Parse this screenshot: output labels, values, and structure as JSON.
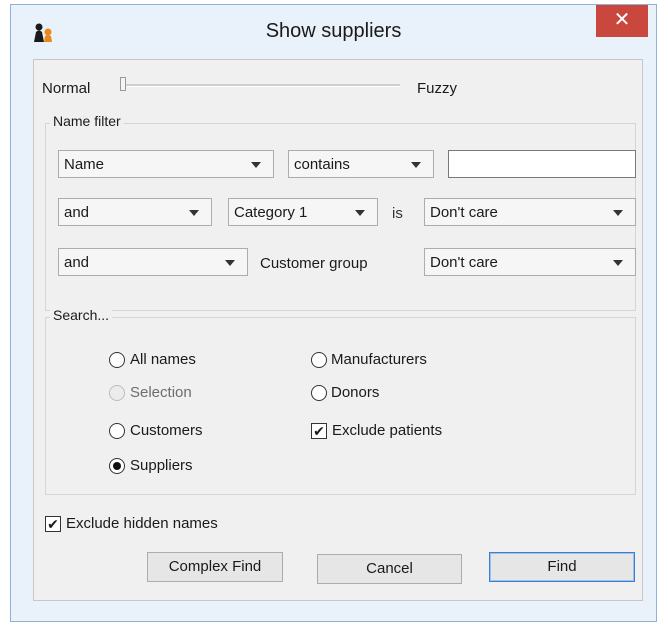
{
  "window": {
    "title": "Show suppliers",
    "close_glyph": "✕"
  },
  "slider": {
    "left_label": "Normal",
    "right_label": "Fuzzy",
    "value": 0
  },
  "name_filter": {
    "legend": "Name filter",
    "row1": {
      "field": "Name",
      "operator": "contains",
      "value": ""
    },
    "row2": {
      "conjunction": "and",
      "field": "Category 1",
      "is_label": "is",
      "value": "Don't care"
    },
    "row3": {
      "conjunction": "and",
      "field_label": "Customer group",
      "value": "Don't care"
    }
  },
  "search": {
    "legend": "Search...",
    "options": {
      "all_names": "All names",
      "selection": "Selection",
      "customers": "Customers",
      "suppliers": "Suppliers",
      "manufacturers": "Manufacturers",
      "donors": "Donors"
    },
    "selected": "suppliers",
    "exclude_patients": {
      "label": "Exclude patients",
      "checked": true
    }
  },
  "exclude_hidden": {
    "label": "Exclude hidden names",
    "checked": true
  },
  "buttons": {
    "complex_find": "Complex Find",
    "cancel": "Cancel",
    "find": "Find"
  },
  "colors": {
    "title_bg": "#e9f1fb",
    "close_bg": "#c9473c",
    "client_bg": "#f0f0f0",
    "default_btn_border": "#3c7fd1"
  }
}
